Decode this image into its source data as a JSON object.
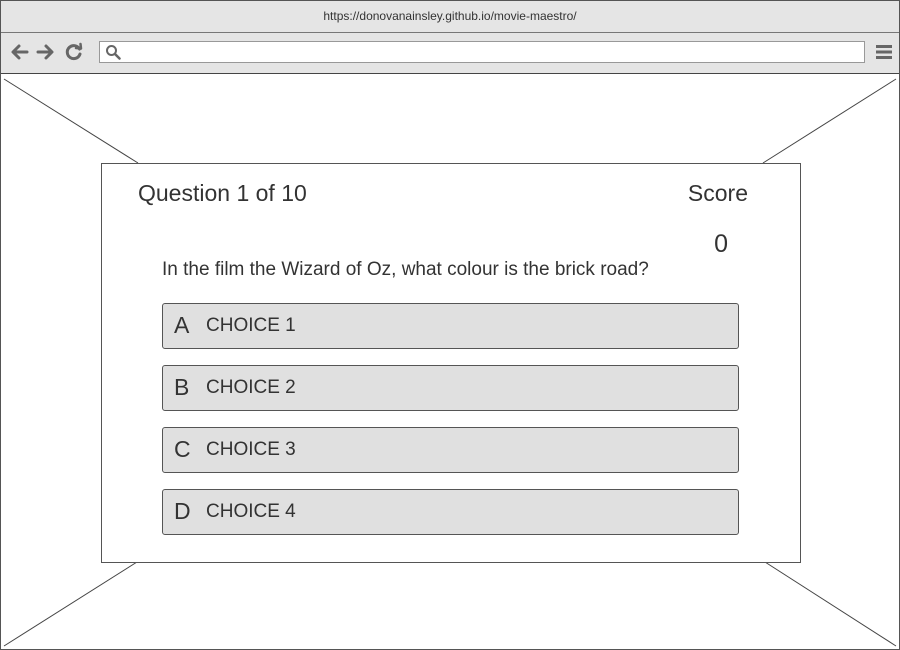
{
  "browser": {
    "url": "https://donovanainsley.github.io/movie-maestro/",
    "search_placeholder": "",
    "icons": {
      "back": "arrow-left-icon",
      "forward": "arrow-right-icon",
      "reload": "reload-icon",
      "search": "search-icon",
      "menu": "hamburger-menu-icon"
    }
  },
  "quiz": {
    "question_counter": "Question 1 of 10",
    "score_label": "Score",
    "score_value": "0",
    "question": "In the film the Wizard of Oz, what colour is the brick road?",
    "choices": [
      {
        "prefix": "A",
        "label": "CHOICE 1"
      },
      {
        "prefix": "B",
        "label": "CHOICE 2"
      },
      {
        "prefix": "C",
        "label": "CHOICE 3"
      },
      {
        "prefix": "D",
        "label": "CHOICE 4"
      }
    ]
  },
  "colors": {
    "chrome_bg": "#e5e5e5",
    "choice_bg": "#e0e0e0",
    "border": "#555555",
    "text": "#333333"
  }
}
